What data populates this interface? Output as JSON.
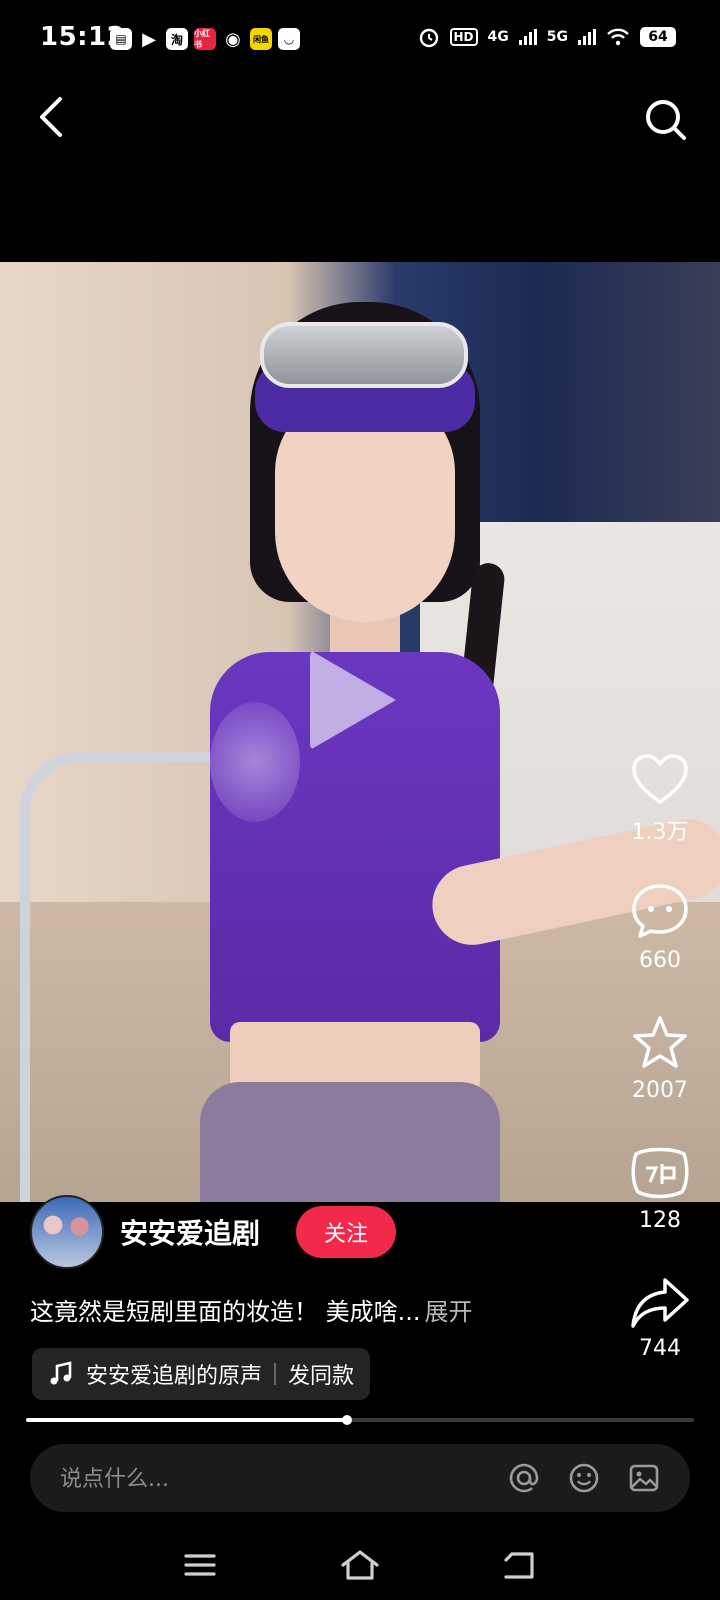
{
  "status_bar": {
    "time": "15:12",
    "app_icons": [
      "bill-icon",
      "play-icon",
      "taobao-icon",
      "xiaohongshu-icon",
      "weibo-icon",
      "xianyu-icon",
      "cat-icon"
    ],
    "app_labels": {
      "taobao": "淘",
      "xiaohongshu": "小红书",
      "xianyu": "闲鱼"
    },
    "hd_label": "HD",
    "network_1": "4G",
    "network_2": "5G",
    "battery": "64"
  },
  "video": {
    "paused": true,
    "progress": 0.48
  },
  "author": {
    "name": "安安爱追剧",
    "follow_label": "关注"
  },
  "caption": {
    "text": "这竟然是短剧里面的妆造！ 美成啥...",
    "expand_label": "展开"
  },
  "music": {
    "title": "安安爱追剧的原声",
    "action_label": "发同款"
  },
  "actions": {
    "likes": "1.3万",
    "comments": "660",
    "favorites": "2007",
    "dubs": "128",
    "shares": "744"
  },
  "comment_bar": {
    "placeholder": "说点什么..."
  },
  "colors": {
    "accent": "#f2294a",
    "background": "#000000"
  }
}
